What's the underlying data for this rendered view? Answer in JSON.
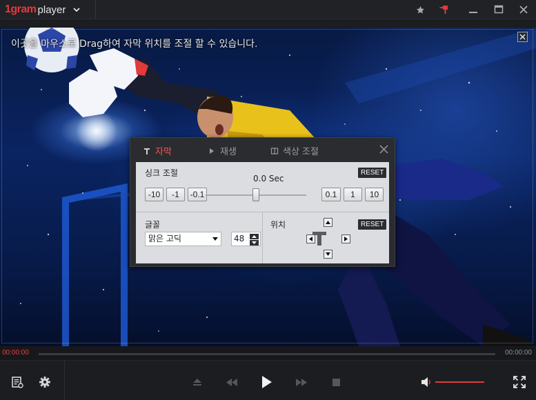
{
  "app": {
    "brand_prefix": "1gram",
    "brand_name": "player"
  },
  "video": {
    "subtitle_hint": "이곳을 마우스로 Drag하여 자막 위치를 조절 할 수 있습니다."
  },
  "panel": {
    "tabs": [
      {
        "label": "자막",
        "icon": "text-T-icon",
        "active": true
      },
      {
        "label": "재생",
        "icon": "play-triangle-icon",
        "active": false
      },
      {
        "label": "색상 조절",
        "icon": "color-adjust-icon",
        "active": false
      }
    ],
    "sync": {
      "label": "싱크 조절",
      "value": "0.0 Sec",
      "reset_label": "RESET",
      "minus_buttons": [
        "-10",
        "-1",
        "-0.1"
      ],
      "plus_buttons": [
        "0.1",
        "1",
        "10"
      ],
      "slider_fraction": 0.5
    },
    "font": {
      "label": "글꼴",
      "selected": "맑은 고딕",
      "size": "48"
    },
    "position": {
      "label": "위치",
      "reset_label": "RESET"
    }
  },
  "player": {
    "time_current": "00:00:00",
    "time_total": "00:00:00",
    "volume_fraction": 1.0,
    "accent_color": "#e33b3b"
  }
}
